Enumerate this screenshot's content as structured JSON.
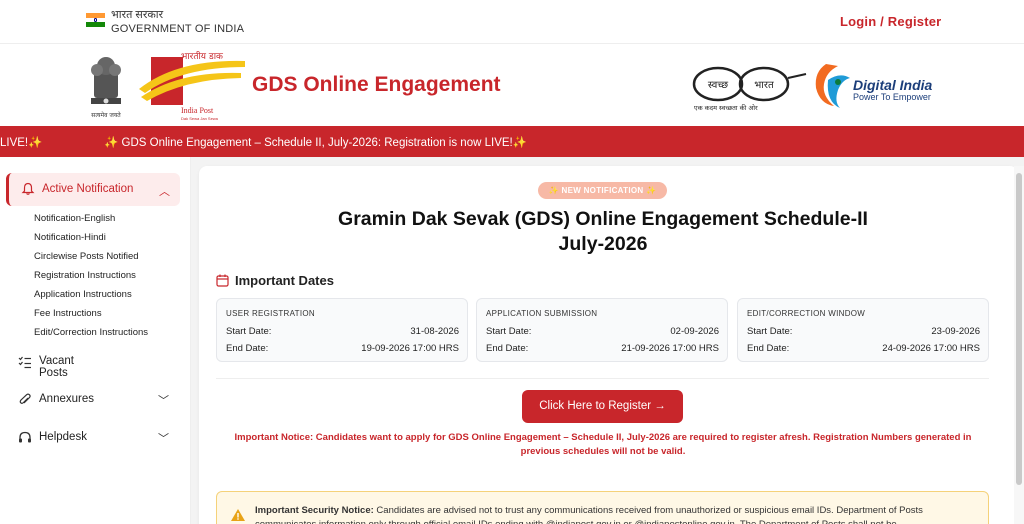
{
  "gov": {
    "hindi": "भारत सरकार",
    "english": "GOVERNMENT OF INDIA"
  },
  "auth": {
    "login_label": "Login / Register"
  },
  "header": {
    "title": "GDS Online Engagement",
    "post_logo_hindi": "भारतीय डाक",
    "post_logo_english": "India Post",
    "post_logo_tag": "Dak Sewa Jan Sewa",
    "emblem_motto": "सत्यमेव जयते",
    "swachh_left": "स्वच्छ",
    "swachh_right": "भारत",
    "swachh_tag": "एक कदम स्वच्छता की ओर",
    "digital_india": "Digital India",
    "digital_tag": "Power To Empower"
  },
  "ticker": {
    "text_left": "LIVE!✨",
    "text_main": "✨ GDS Online Engagement – Schedule II, July-2026: Registration is now LIVE!✨"
  },
  "sidebar": {
    "active": {
      "label": "Active Notification",
      "icon": "bell-icon",
      "chevron": "chevron-up-icon"
    },
    "subitems": [
      "Notification-English",
      "Notification-Hindi",
      "Circlewise Posts Notified",
      "Registration Instructions",
      "Application Instructions",
      "Fee Instructions",
      "Edit/Correction Instructions"
    ],
    "items": [
      {
        "label": "Vacant Posts",
        "icon": "list-check-icon"
      },
      {
        "label": "Annexures",
        "icon": "paperclip-icon"
      },
      {
        "label": "Helpdesk",
        "icon": "headset-icon"
      }
    ]
  },
  "main": {
    "badge": "✨ NEW NOTIFICATION ✨",
    "headline_line1": "Gramin Dak Sevak (GDS) Online Engagement Schedule-II",
    "headline_line2": "July-2026",
    "dates_title": "Important Dates",
    "date_boxes": [
      {
        "title": "USER REGISTRATION",
        "start_label": "Start Date:",
        "start": "31-08-2026",
        "end_label": "End Date:",
        "end": "19-09-2026 17:00 HRS"
      },
      {
        "title": "APPLICATION SUBMISSION",
        "start_label": "Start Date:",
        "start": "02-09-2026",
        "end_label": "End Date:",
        "end": "21-09-2026 17:00 HRS"
      },
      {
        "title": "EDIT/CORRECTION WINDOW",
        "start_label": "Start Date:",
        "start": "23-09-2026",
        "end_label": "End Date:",
        "end": "24-09-2026 17:00 HRS"
      }
    ],
    "register_button": "Click Here to Register  →",
    "notice": "Important Notice: Candidates want to apply for GDS Online Engagement – Schedule II, July-2026 are required to register afresh. Registration Numbers generated in previous schedules will not be valid.",
    "security_label": "Important Security Notice:",
    "security_text": " Candidates are advised not to trust any communications received from unauthorized or suspicious email IDs. Department of Posts communicates information only through official email IDs ending with @indiapost.gov.in or @indiapostonline.gov.in. The Department of Posts shall not be"
  },
  "colors": {
    "brand_red": "#c8262b",
    "ticker_bg": "#c8262b",
    "active_bg": "#fdecec"
  }
}
